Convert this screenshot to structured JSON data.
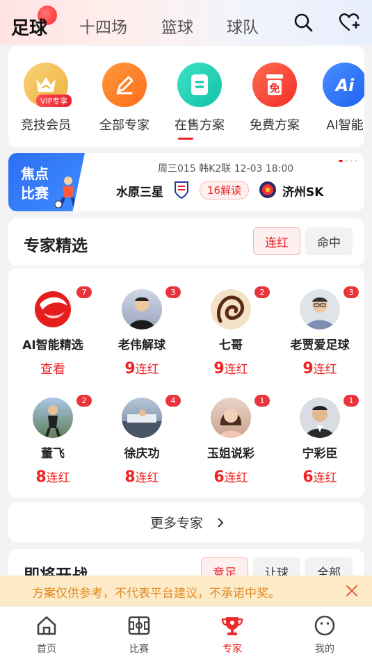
{
  "top_tabs": [
    {
      "label": "足球",
      "active": true
    },
    {
      "label": "十四场",
      "active": false
    },
    {
      "label": "篮球",
      "active": false
    },
    {
      "label": "球队",
      "active": false
    }
  ],
  "categories": [
    {
      "label": "竞技会员",
      "icon": "crown-icon",
      "color": "#f5c15a",
      "badge": "VIP专享"
    },
    {
      "label": "全部专家",
      "icon": "pen-icon",
      "color": "#ff7a1f"
    },
    {
      "label": "在售方案",
      "icon": "doc-icon",
      "color": "#1fd1b6"
    },
    {
      "label": "免费方案",
      "icon": "free-icon",
      "color": "#ff4a3a"
    },
    {
      "label": "AI智能",
      "icon": "ai-icon",
      "color": "#2f7bff"
    }
  ],
  "focus_match": {
    "tag_line1": "焦点",
    "tag_line2": "比赛",
    "info": "周三015  韩K2联  12-03 18:00",
    "home": "水原三星",
    "away": "济州SK",
    "reads": "16解读"
  },
  "expert_section": {
    "title": "专家精选",
    "filters": [
      {
        "label": "连红",
        "active": true
      },
      {
        "label": "命中",
        "active": false
      }
    ]
  },
  "experts": [
    {
      "name": "AI智能精选",
      "badge": "7",
      "action": "查看"
    },
    {
      "name": "老伟解球",
      "badge": "3",
      "streak": "9",
      "suffix": "连红"
    },
    {
      "name": "七哥",
      "badge": "2",
      "streak": "9",
      "suffix": "连红"
    },
    {
      "name": "老贾爱足球",
      "badge": "3",
      "streak": "9",
      "suffix": "连红"
    },
    {
      "name": "董飞",
      "badge": "2",
      "streak": "8",
      "suffix": "连红"
    },
    {
      "name": "徐庆功",
      "badge": "4",
      "streak": "8",
      "suffix": "连红"
    },
    {
      "name": "玉姐说彩",
      "badge": "1",
      "streak": "6",
      "suffix": "连红"
    },
    {
      "name": "宁彩臣",
      "badge": "1",
      "streak": "6",
      "suffix": "连红"
    }
  ],
  "more_experts": "更多专家",
  "upcoming": {
    "title": "即将开战",
    "filters": [
      {
        "label": "竞足",
        "active": true
      },
      {
        "label": "让球",
        "active": false
      },
      {
        "label": "全部",
        "active": false
      }
    ]
  },
  "notice": "方案仅供参考，不代表平台建议，不承诺中奖。",
  "bottom_tabs": [
    {
      "label": "首页",
      "icon": "home-icon",
      "active": false
    },
    {
      "label": "比赛",
      "icon": "pitch-icon",
      "active": false
    },
    {
      "label": "专家",
      "icon": "trophy-icon",
      "active": true
    },
    {
      "label": "我的",
      "icon": "smile-icon",
      "active": false
    }
  ]
}
